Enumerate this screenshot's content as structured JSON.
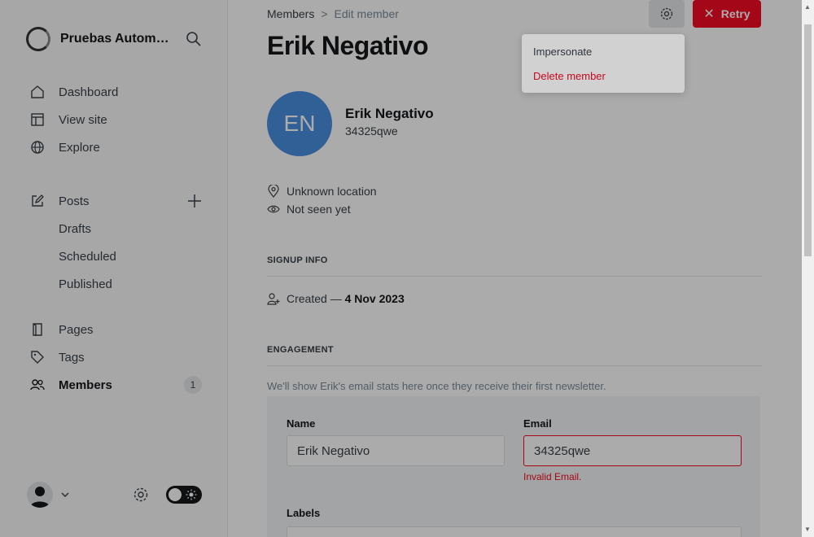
{
  "sidebar": {
    "brand_name": "Pruebas Automatizadas",
    "nav": [
      {
        "label": "Dashboard"
      },
      {
        "label": "View site"
      },
      {
        "label": "Explore"
      }
    ],
    "posts": {
      "label": "Posts",
      "sub": [
        "Drafts",
        "Scheduled",
        "Published"
      ]
    },
    "more": [
      {
        "label": "Pages"
      },
      {
        "label": "Tags"
      },
      {
        "label": "Members",
        "badge": "1"
      }
    ]
  },
  "header": {
    "breadcrumb_parent": "Members",
    "breadcrumb_separator": ">",
    "breadcrumb_current": "Edit member",
    "retry_label": "Retry",
    "retry_icon": "close-icon"
  },
  "dropdown": {
    "items": [
      {
        "label": "Impersonate",
        "color": "#394047"
      },
      {
        "label": "Delete member",
        "color": "#f50b23"
      }
    ]
  },
  "member": {
    "title": "Erik Negativo",
    "initials": "EN",
    "name": "Erik Negativo",
    "email": "34325qwe",
    "avatar_color": "#4a90e2",
    "location": "Unknown location",
    "seen": "Not seen yet"
  },
  "signup": {
    "heading": "SIGNUP INFO",
    "created_prefix": "Created —",
    "created_date": "4 Nov 2023"
  },
  "engagement": {
    "heading": "ENGAGEMENT",
    "hint": "We'll show Erik's email stats here once they receive their first newsletter."
  },
  "form": {
    "name_label": "Name",
    "name_value": "Erik Negativo",
    "email_label": "Email",
    "email_value": "34325qwe",
    "email_error": "Invalid Email.",
    "labels_label": "Labels"
  },
  "colors": {
    "accent_red": "#f50b23",
    "overlay": "rgba(0,0,0,0.33)"
  }
}
